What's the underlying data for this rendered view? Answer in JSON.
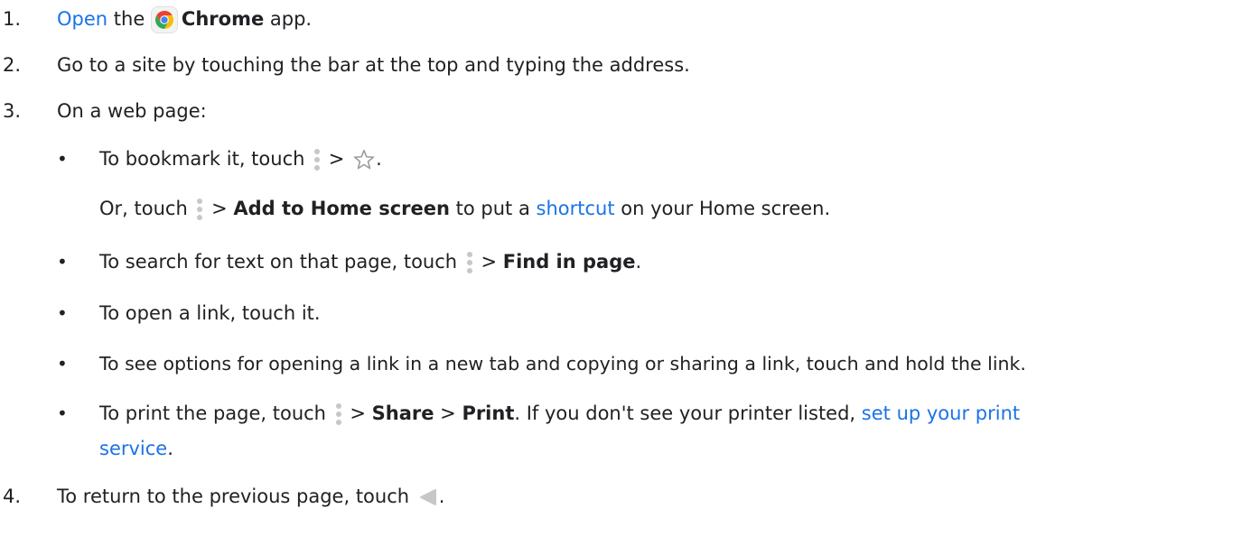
{
  "steps": [
    {
      "number": "1.",
      "link": "Open",
      "mid": " the ",
      "app_name": "Chrome",
      "tail": " app."
    },
    {
      "number": "2.",
      "text": "Go to a site by touching the bar at the top and typing the address."
    },
    {
      "number": "3.",
      "text": "On a web page:"
    },
    {
      "number": "4.",
      "text": "To return to the previous page, touch ",
      "tail": "."
    }
  ],
  "bullets": {
    "bookmark": {
      "text": "To bookmark it, touch ",
      "sep": " > ",
      "end": "."
    },
    "home_screen": {
      "pre": "Or, touch ",
      "sep": " > ",
      "bold": "Add to Home screen",
      "mid": " to put a ",
      "link": "shortcut",
      "tail": " on your Home screen."
    },
    "find": {
      "pre": "To search for text on that page, touch ",
      "sep": " > ",
      "bold": "Find in page",
      "tail": "."
    },
    "open_link": {
      "text": "To open a link, touch it."
    },
    "options": {
      "text": "To see options for opening a link in a new tab and copying or sharing a link, touch and hold the link."
    },
    "print": {
      "pre": "To print the page, touch ",
      "sep1": " > ",
      "bold1": "Share",
      "sep2": " > ",
      "bold2": "Print",
      "mid": ". If you don't see your printer listed, ",
      "link1": "set up your print",
      "link2": "service",
      "tail": "."
    }
  },
  "icons": {
    "chrome": "chrome-icon",
    "more": "more-vert-icon",
    "star": "star-outline-icon",
    "back": "back-triangle-icon"
  },
  "colors": {
    "link": "#1a73e8",
    "text": "#202124",
    "icon_gray": "#c7c7c7"
  }
}
